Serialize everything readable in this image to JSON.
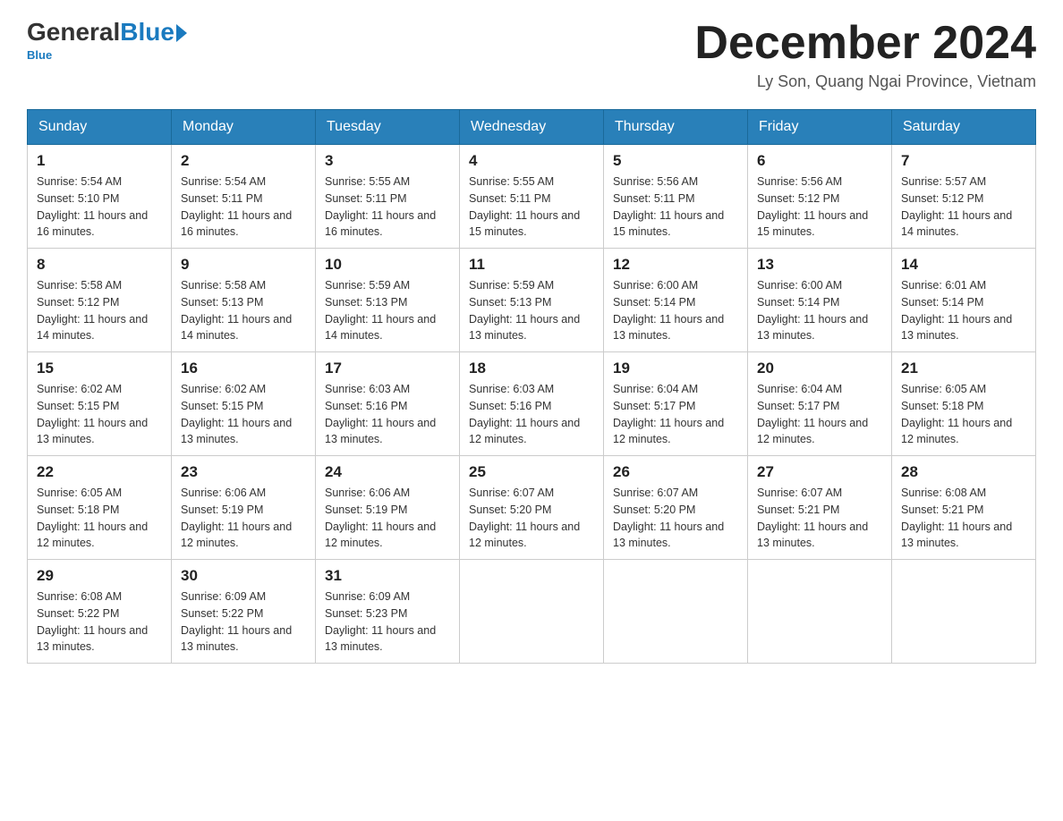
{
  "header": {
    "logo": {
      "general": "General",
      "blue": "Blue",
      "subtitle": "Blue"
    },
    "title": "December 2024",
    "location": "Ly Son, Quang Ngai Province, Vietnam"
  },
  "days_of_week": [
    "Sunday",
    "Monday",
    "Tuesday",
    "Wednesday",
    "Thursday",
    "Friday",
    "Saturday"
  ],
  "weeks": [
    [
      {
        "day": "1",
        "sunrise": "5:54 AM",
        "sunset": "5:10 PM",
        "daylight": "11 hours and 16 minutes."
      },
      {
        "day": "2",
        "sunrise": "5:54 AM",
        "sunset": "5:11 PM",
        "daylight": "11 hours and 16 minutes."
      },
      {
        "day": "3",
        "sunrise": "5:55 AM",
        "sunset": "5:11 PM",
        "daylight": "11 hours and 16 minutes."
      },
      {
        "day": "4",
        "sunrise": "5:55 AM",
        "sunset": "5:11 PM",
        "daylight": "11 hours and 15 minutes."
      },
      {
        "day": "5",
        "sunrise": "5:56 AM",
        "sunset": "5:11 PM",
        "daylight": "11 hours and 15 minutes."
      },
      {
        "day": "6",
        "sunrise": "5:56 AM",
        "sunset": "5:12 PM",
        "daylight": "11 hours and 15 minutes."
      },
      {
        "day": "7",
        "sunrise": "5:57 AM",
        "sunset": "5:12 PM",
        "daylight": "11 hours and 14 minutes."
      }
    ],
    [
      {
        "day": "8",
        "sunrise": "5:58 AM",
        "sunset": "5:12 PM",
        "daylight": "11 hours and 14 minutes."
      },
      {
        "day": "9",
        "sunrise": "5:58 AM",
        "sunset": "5:13 PM",
        "daylight": "11 hours and 14 minutes."
      },
      {
        "day": "10",
        "sunrise": "5:59 AM",
        "sunset": "5:13 PM",
        "daylight": "11 hours and 14 minutes."
      },
      {
        "day": "11",
        "sunrise": "5:59 AM",
        "sunset": "5:13 PM",
        "daylight": "11 hours and 13 minutes."
      },
      {
        "day": "12",
        "sunrise": "6:00 AM",
        "sunset": "5:14 PM",
        "daylight": "11 hours and 13 minutes."
      },
      {
        "day": "13",
        "sunrise": "6:00 AM",
        "sunset": "5:14 PM",
        "daylight": "11 hours and 13 minutes."
      },
      {
        "day": "14",
        "sunrise": "6:01 AM",
        "sunset": "5:14 PM",
        "daylight": "11 hours and 13 minutes."
      }
    ],
    [
      {
        "day": "15",
        "sunrise": "6:02 AM",
        "sunset": "5:15 PM",
        "daylight": "11 hours and 13 minutes."
      },
      {
        "day": "16",
        "sunrise": "6:02 AM",
        "sunset": "5:15 PM",
        "daylight": "11 hours and 13 minutes."
      },
      {
        "day": "17",
        "sunrise": "6:03 AM",
        "sunset": "5:16 PM",
        "daylight": "11 hours and 13 minutes."
      },
      {
        "day": "18",
        "sunrise": "6:03 AM",
        "sunset": "5:16 PM",
        "daylight": "11 hours and 12 minutes."
      },
      {
        "day": "19",
        "sunrise": "6:04 AM",
        "sunset": "5:17 PM",
        "daylight": "11 hours and 12 minutes."
      },
      {
        "day": "20",
        "sunrise": "6:04 AM",
        "sunset": "5:17 PM",
        "daylight": "11 hours and 12 minutes."
      },
      {
        "day": "21",
        "sunrise": "6:05 AM",
        "sunset": "5:18 PM",
        "daylight": "11 hours and 12 minutes."
      }
    ],
    [
      {
        "day": "22",
        "sunrise": "6:05 AM",
        "sunset": "5:18 PM",
        "daylight": "11 hours and 12 minutes."
      },
      {
        "day": "23",
        "sunrise": "6:06 AM",
        "sunset": "5:19 PM",
        "daylight": "11 hours and 12 minutes."
      },
      {
        "day": "24",
        "sunrise": "6:06 AM",
        "sunset": "5:19 PM",
        "daylight": "11 hours and 12 minutes."
      },
      {
        "day": "25",
        "sunrise": "6:07 AM",
        "sunset": "5:20 PM",
        "daylight": "11 hours and 12 minutes."
      },
      {
        "day": "26",
        "sunrise": "6:07 AM",
        "sunset": "5:20 PM",
        "daylight": "11 hours and 13 minutes."
      },
      {
        "day": "27",
        "sunrise": "6:07 AM",
        "sunset": "5:21 PM",
        "daylight": "11 hours and 13 minutes."
      },
      {
        "day": "28",
        "sunrise": "6:08 AM",
        "sunset": "5:21 PM",
        "daylight": "11 hours and 13 minutes."
      }
    ],
    [
      {
        "day": "29",
        "sunrise": "6:08 AM",
        "sunset": "5:22 PM",
        "daylight": "11 hours and 13 minutes."
      },
      {
        "day": "30",
        "sunrise": "6:09 AM",
        "sunset": "5:22 PM",
        "daylight": "11 hours and 13 minutes."
      },
      {
        "day": "31",
        "sunrise": "6:09 AM",
        "sunset": "5:23 PM",
        "daylight": "11 hours and 13 minutes."
      },
      null,
      null,
      null,
      null
    ]
  ],
  "labels": {
    "sunrise": "Sunrise:",
    "sunset": "Sunset:",
    "daylight": "Daylight:"
  }
}
